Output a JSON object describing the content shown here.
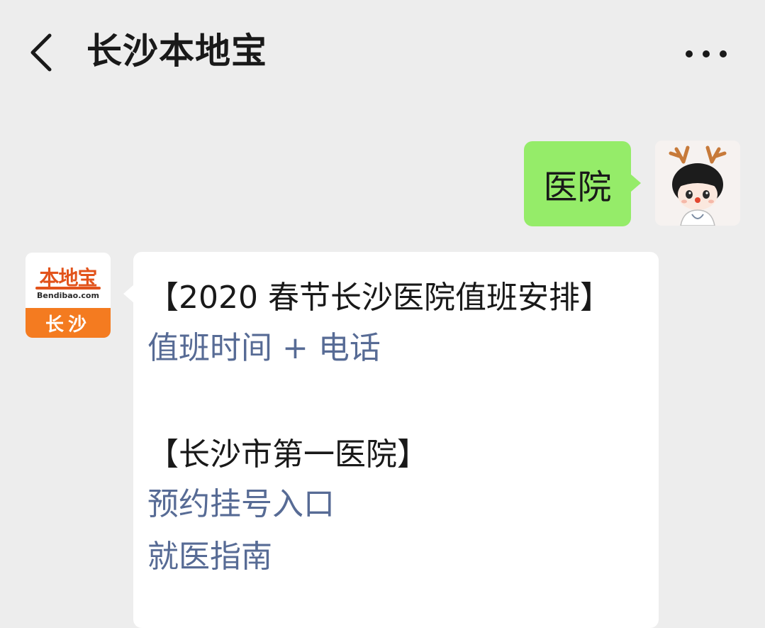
{
  "header": {
    "title": "长沙本地宝",
    "back_icon": "chevron-left-icon",
    "more_icon": "more-horizontal-icon"
  },
  "chat": {
    "outgoing": {
      "text": "医院",
      "bubble_color": "#95ec69"
    },
    "incoming": {
      "account_logo": {
        "main": "本地宝",
        "site": "Bendibao.com",
        "city": "长沙",
        "brand_color": "#f47b20"
      },
      "lines": [
        {
          "text": "【2020 春节长沙医院值班安排】",
          "type": "text"
        },
        {
          "text": "值班时间 + 电话",
          "type": "link"
        },
        {
          "text": "【长沙市第一医院】",
          "type": "text"
        },
        {
          "text": "预约挂号入口",
          "type": "link"
        },
        {
          "text": "就医指南",
          "type": "link"
        }
      ],
      "link_color": "#576b95"
    }
  }
}
